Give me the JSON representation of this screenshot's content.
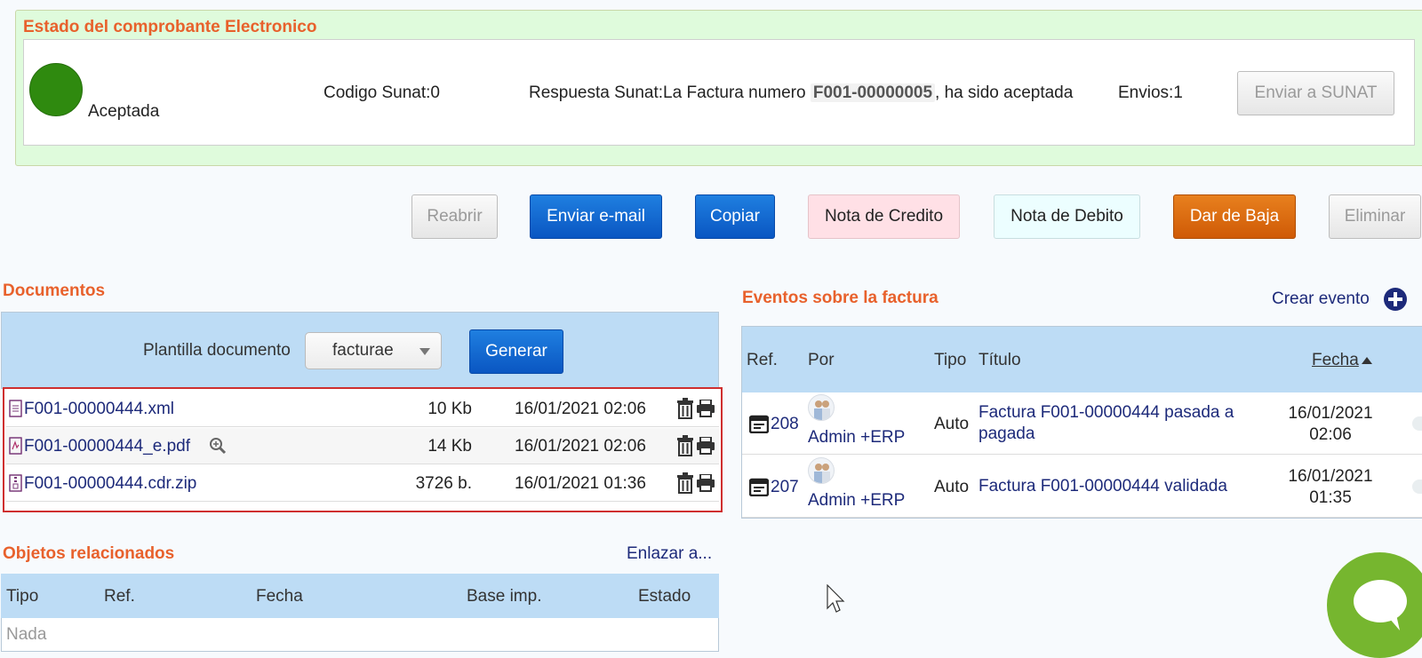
{
  "status": {
    "title": "Estado del comprobante Electronico",
    "state_label": "Aceptada",
    "codigo": "Codigo Sunat:0",
    "respuesta_prefix": "Respuesta Sunat:La Factura numero",
    "invoice_number": "F001-00000005",
    "respuesta_suffix": ", ha sido aceptada",
    "envios": "Envios:1",
    "send_button": "Enviar a SUNAT",
    "colors": {
      "accepted": "#2f8a0f",
      "panel": "#dffbdc"
    }
  },
  "actions": {
    "reopen": "Reabrir",
    "send_email": "Enviar e-mail",
    "copy": "Copiar",
    "credit_note": "Nota de Credito",
    "debit_note": "Nota de Debito",
    "cancel": "Dar de Baja",
    "delete": "Eliminar"
  },
  "documents": {
    "title": "Documentos",
    "template_label": "Plantilla documento",
    "template_value": "facturae",
    "generate_button": "Generar",
    "files": [
      {
        "name": "F001-00000444.xml",
        "size": "10 Kb",
        "date": "16/01/2021 02:06"
      },
      {
        "name": "F001-00000444_e.pdf",
        "size": "14 Kb",
        "date": "16/01/2021 02:06"
      },
      {
        "name": "F001-00000444.cdr.zip",
        "size": "3726 b.",
        "date": "16/01/2021 01:36"
      }
    ]
  },
  "related": {
    "title": "Objetos relacionados",
    "link_label": "Enlazar a...",
    "columns": [
      "Tipo",
      "Ref.",
      "Fecha",
      "Base imp.",
      "Estado"
    ],
    "empty": "Nada"
  },
  "events": {
    "title": "Eventos sobre la factura",
    "create_label": "Crear evento",
    "columns": {
      "ref": "Ref.",
      "by": "Por",
      "type": "Tipo",
      "title": "Título",
      "date": "Fecha"
    },
    "rows": [
      {
        "ref": "208",
        "by": "Admin +ERP",
        "type": "Auto",
        "title": "Factura F001-00000444 pasada a pagada",
        "date": "16/01/2021",
        "time": "02:06"
      },
      {
        "ref": "207",
        "by": "Admin +ERP",
        "type": "Auto",
        "title": "Factura F001-00000444 validada",
        "date": "16/01/2021",
        "time": "01:35"
      }
    ]
  }
}
